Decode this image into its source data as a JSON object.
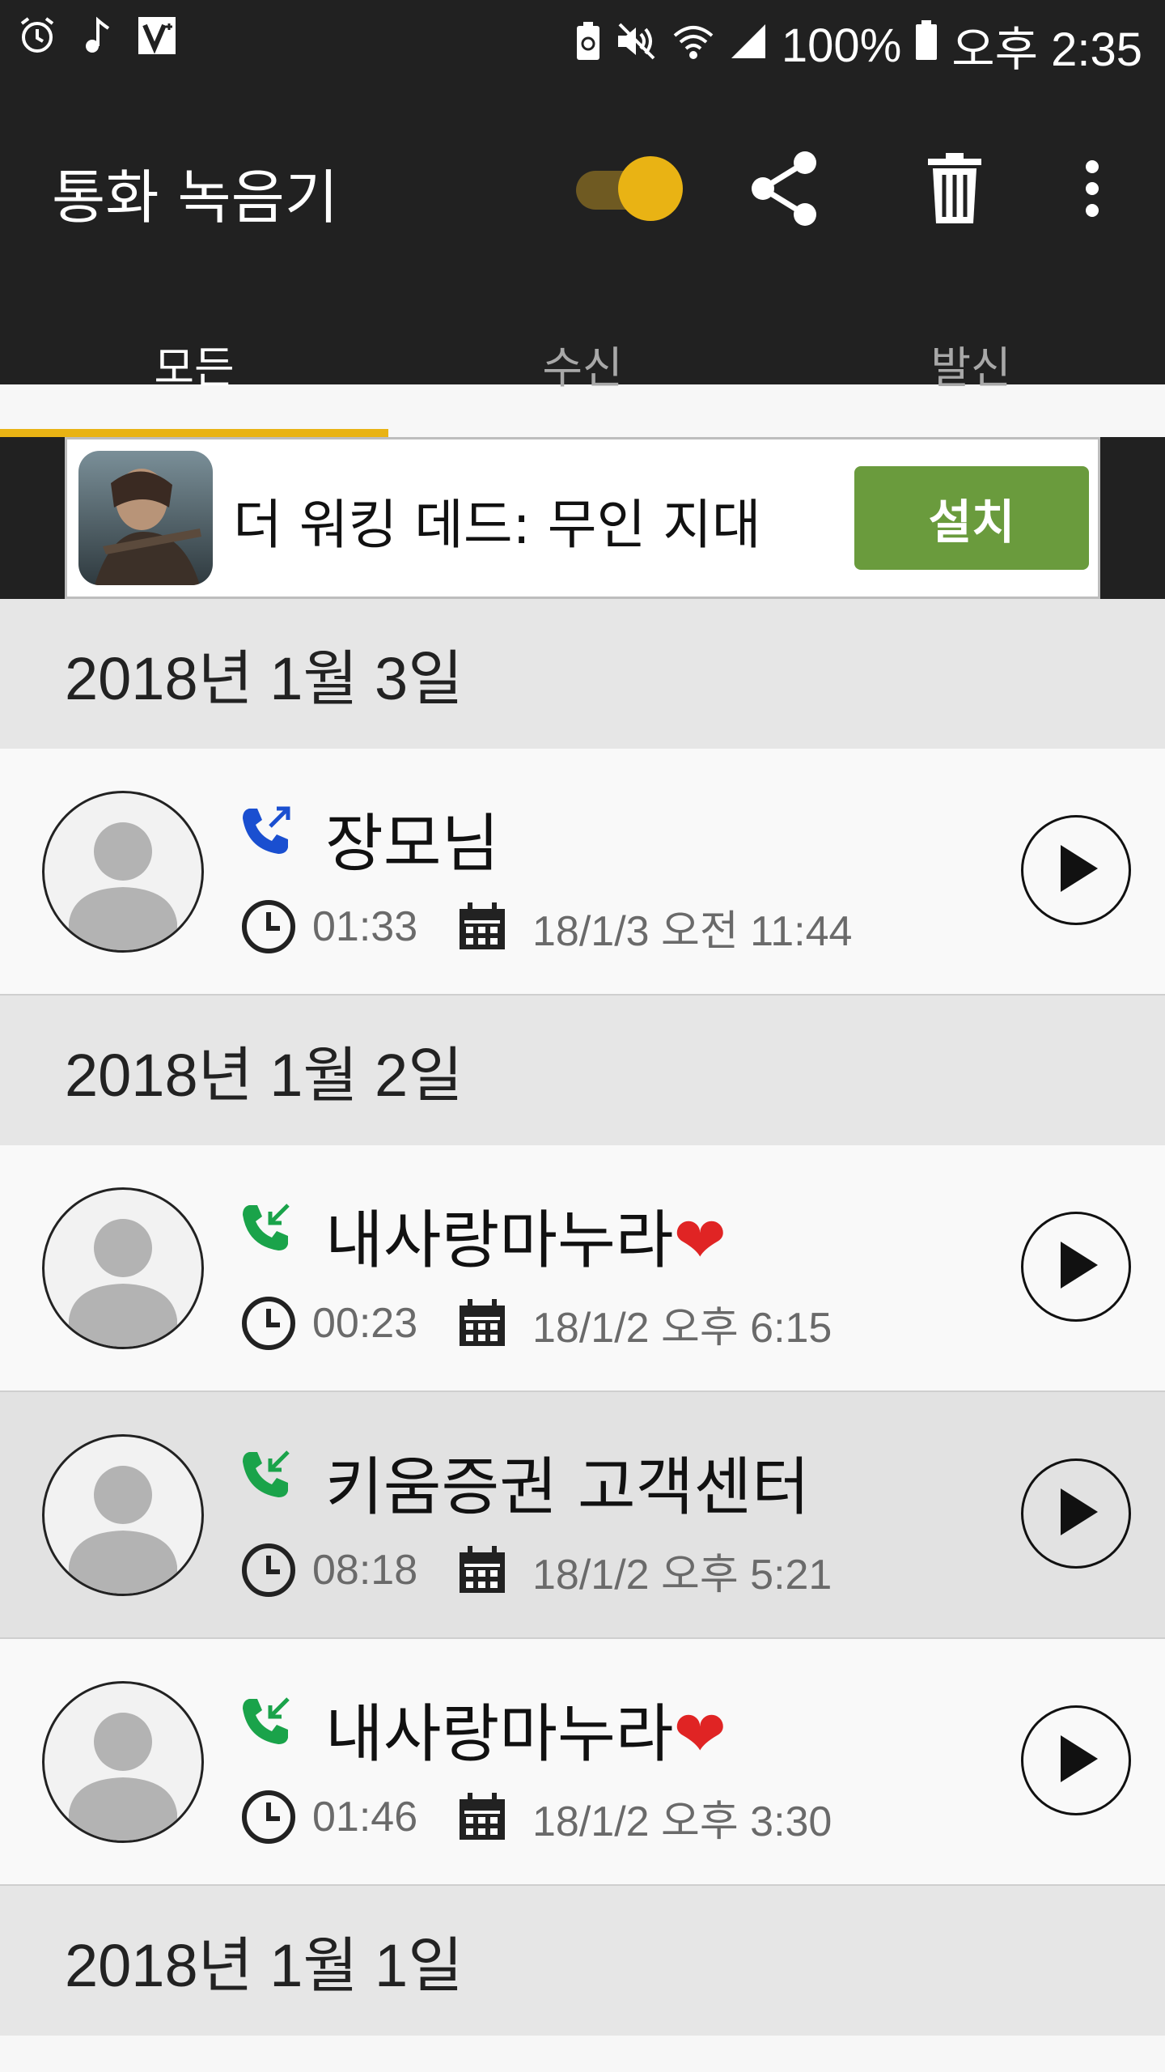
{
  "status_bar": {
    "battery": "100%",
    "time": "오후 2:35",
    "left_icons": [
      "alarm-icon",
      "music-note-icon",
      "v3-app-icon"
    ],
    "right_icons": [
      "battery-saver-icon",
      "mute-icon",
      "wifi-icon",
      "signal-icon",
      "battery-icon"
    ]
  },
  "toolbar": {
    "title": "통화 녹음기",
    "toggle_on": true,
    "accent": "#e9b314"
  },
  "tabs": [
    {
      "label": "모든",
      "active": true
    },
    {
      "label": "수신",
      "active": false
    },
    {
      "label": "발신",
      "active": false
    }
  ],
  "ad": {
    "title": "더 워킹 데드: 무인 지대",
    "button": "설치",
    "button_color": "#6a9b3d"
  },
  "sections": [
    {
      "date": "2018년 1월 3일",
      "calls": [
        {
          "name": "장모님",
          "direction": "outgoing",
          "duration": "01:33",
          "datetime": "18/1/3 오전 11:44",
          "heart": false
        }
      ]
    },
    {
      "date": "2018년 1월 2일",
      "calls": [
        {
          "name": "내사랑마누라",
          "direction": "incoming",
          "duration": "00:23",
          "datetime": "18/1/2 오후 6:15",
          "heart": true
        },
        {
          "name": "키움증권 고객센터",
          "direction": "incoming",
          "duration": "08:18",
          "datetime": "18/1/2 오후 5:21",
          "heart": false
        },
        {
          "name": "내사랑마누라",
          "direction": "incoming",
          "duration": "01:46",
          "datetime": "18/1/2 오후 3:30",
          "heart": true
        }
      ]
    },
    {
      "date": "2018년 1월 1일",
      "calls": []
    }
  ]
}
